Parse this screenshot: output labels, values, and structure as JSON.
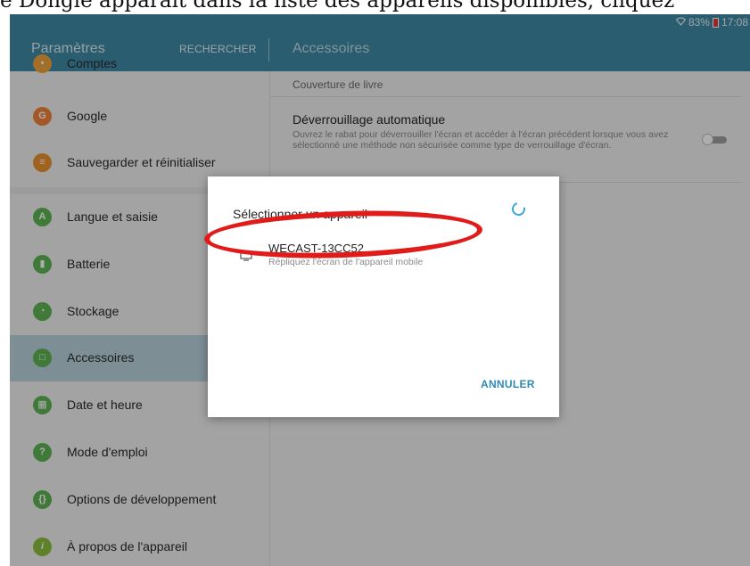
{
  "caption": "e Dongle apparaît dans la liste des appareils disponibles, cliquez",
  "status": {
    "battery": "83%",
    "time": "17:08"
  },
  "appbar": {
    "title": "Paramètres",
    "search": "RECHERCHER",
    "section": "Accessoires"
  },
  "sidebar": {
    "items": [
      {
        "label": "Comptes",
        "icon": "accounts-icon",
        "color": "#f0a33a"
      },
      {
        "label": "Google",
        "icon": "google-icon",
        "color": "#f0843a"
      },
      {
        "label": "Sauvegarder et réinitialiser",
        "icon": "backup-icon",
        "color": "#e8922e"
      },
      {
        "label": "Langue et saisie",
        "icon": "language-icon",
        "color": "#5fb454"
      },
      {
        "label": "Batterie",
        "icon": "battery-icon",
        "color": "#5fb454"
      },
      {
        "label": "Stockage",
        "icon": "storage-icon",
        "color": "#5fb454"
      },
      {
        "label": "Accessoires",
        "icon": "accessories-icon",
        "color": "#5fb454"
      },
      {
        "label": "Date et heure",
        "icon": "date-icon",
        "color": "#5fb454"
      },
      {
        "label": "Mode d'emploi",
        "icon": "manual-icon",
        "color": "#5fb454"
      },
      {
        "label": "Options de développement",
        "icon": "developer-icon",
        "color": "#5fb454"
      },
      {
        "label": "À propos de l'appareil",
        "icon": "info-icon",
        "color": "#8cbf3f"
      }
    ]
  },
  "main": {
    "cover_label": "Couverture de livre",
    "auto_unlock_title": "Déverrouillage automatique",
    "auto_unlock_desc": "Ouvrez le rabat pour déverrouiller l'écran et accéder à l'écran précédent lorsque vous avez sélectionné une méthode non sécurisée comme type de verrouillage d'écran."
  },
  "dialog": {
    "title": "Sélectionner un appareil",
    "device_name": "WECAST-13CC52",
    "device_desc": "Répliquez l'écran de l'appareil mobile",
    "cancel": "ANNULER"
  }
}
